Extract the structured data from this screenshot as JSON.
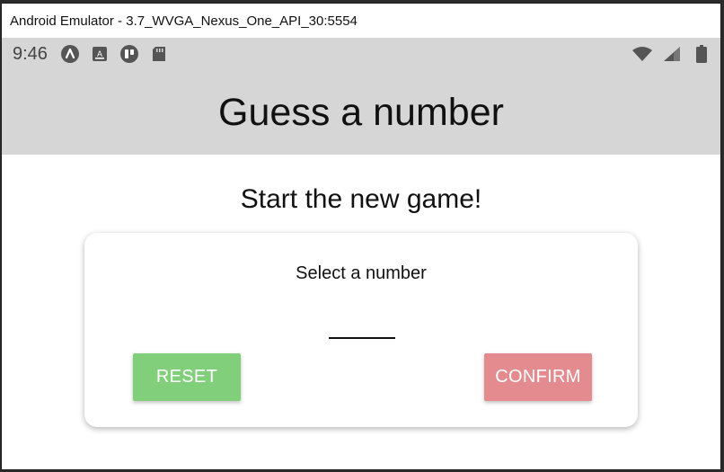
{
  "window": {
    "title": "Android Emulator - 3.7_WVGA_Nexus_One_API_30:5554"
  },
  "statusbar": {
    "time": "9:46",
    "left_icons": [
      "app-icon",
      "text-icon",
      "tablet-icon",
      "sd-card-icon"
    ],
    "right_icons": [
      "wifi-icon",
      "signal-icon",
      "battery-icon"
    ]
  },
  "app": {
    "title": "Guess a number",
    "subtitle": "Start the new game!",
    "card": {
      "label": "Select a number",
      "input_value": "",
      "reset_label": "RESET",
      "confirm_label": "CONFIRM"
    }
  },
  "colors": {
    "header_bg": "#d6d6d6",
    "reset_button": "#82cf7b",
    "confirm_button": "#e38b8e"
  }
}
